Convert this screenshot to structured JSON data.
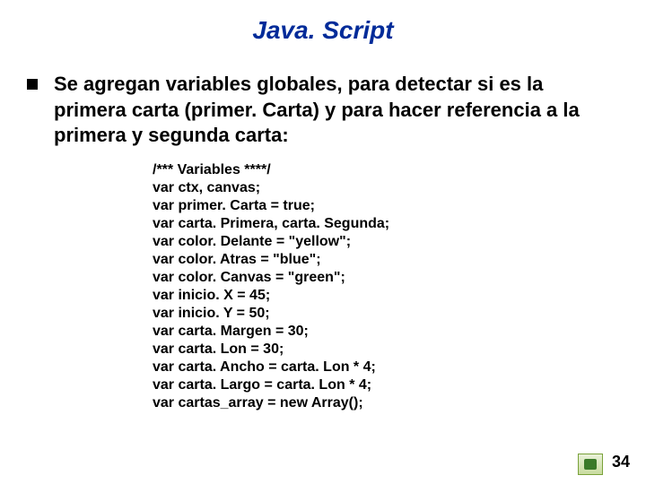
{
  "title": "Java. Script",
  "bullet_text": "Se agregan variables globales, para detectar si es la primera carta (primer. Carta) y para hacer referencia a la primera y segunda carta:",
  "code": "/*** Variables ****/\nvar ctx, canvas;\nvar primer. Carta = true;\nvar carta. Primera, carta. Segunda;\nvar color. Delante = \"yellow\";\nvar color. Atras = \"blue\";\nvar color. Canvas = \"green\";\nvar inicio. X = 45;\nvar inicio. Y = 50;\nvar carta. Margen = 30;\nvar carta. Lon = 30;\nvar carta. Ancho = carta. Lon * 4;\nvar carta. Largo = carta. Lon * 4;\nvar cartas_array = new Array();",
  "page_number": "34"
}
